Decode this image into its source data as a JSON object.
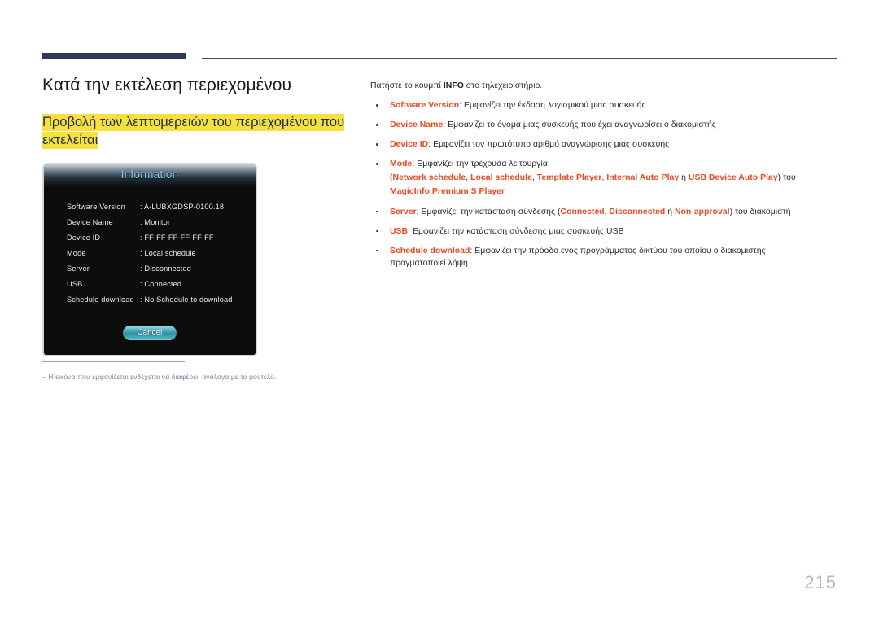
{
  "header": {
    "rule_color_thick": "#2e3a5c",
    "rule_color_thin": "#45476b"
  },
  "left": {
    "page_title": "Κατά την εκτέλεση περιεχομένου",
    "section_heading": "Προβολή των λεπτομερειών του περιεχομένου που εκτελείται",
    "highlight_color": "#f5e03c"
  },
  "osd": {
    "title": "Information",
    "title_color": "#7fd4f2",
    "rows": [
      {
        "label": "Software Version",
        "value": ": A-LUBXGDSP-0100.18"
      },
      {
        "label": "Device Name",
        "value": ": Monitor"
      },
      {
        "label": "Device ID",
        "value": ": FF-FF-FF-FF-FF-FF"
      },
      {
        "label": "Mode",
        "value": ": Local schedule"
      },
      {
        "label": "Server",
        "value": ": Disconnected"
      },
      {
        "label": "USB",
        "value": ": Connected"
      },
      {
        "label": "Schedule download",
        "value": ": No Schedule to download"
      }
    ],
    "cancel_label": "Cancel"
  },
  "footnote": {
    "text": "‒  Η εικόνα που εμφανίζεται ενδέχεται να διαφέρει, ανάλογα με το μοντέλο.",
    "color": "#7b86a3"
  },
  "right": {
    "intro_before": "Πατήστε το κουμπί ",
    "intro_kbd": "INFO",
    "intro_after": " στο τηλεχειριστήριο.",
    "term_color": "#e8481f",
    "bullets": [
      {
        "term": "Software Version",
        "rest": ": Εμφανίζει την έκδοση λογισμικού μιας συσκευής"
      },
      {
        "term": "Device Name",
        "rest": ": Εμφανίζει το όνομα μιας συσκευής που έχει αναγνωρίσει ο διακομιστής"
      },
      {
        "term": "Device ID",
        "rest": ": Εμφανίζει τον πρωτότυπο αριθμό αναγνώρισης μιας συσκευής"
      },
      {
        "term": "Mode",
        "rest": ": Εμφανίζει την τρέχουσα λειτουργία",
        "sub": {
          "open_paren": "(",
          "items": [
            "Network schedule",
            "Local schedule",
            "Template Player",
            "Internal Auto Play"
          ],
          "or_word": " ή ",
          "last_item": "USB Device Auto Play",
          "close_paren": ") του",
          "second_line": "MagicInfo Premium S Player"
        }
      },
      {
        "term": "Server",
        "rest_a": ": Εμφανίζει την κατάσταση σύνδεσης (",
        "inline_terms": [
          "Connected",
          "Disconnected",
          "Non-approval"
        ],
        "or_word": " ή ",
        "rest_b": ") του διακομιστή"
      },
      {
        "term": "USB",
        "rest": ": Εμφανίζει την κατάσταση σύνδεσης μιας συσκευής USB"
      },
      {
        "term": "Schedule download",
        "rest": ": Εμφανίζει την πρόοδο ενός προγράμματος δικτύου του οποίου ο διακομιστής",
        "cont": "πραγματοποιεί λήψη"
      }
    ]
  },
  "page_number": "215"
}
